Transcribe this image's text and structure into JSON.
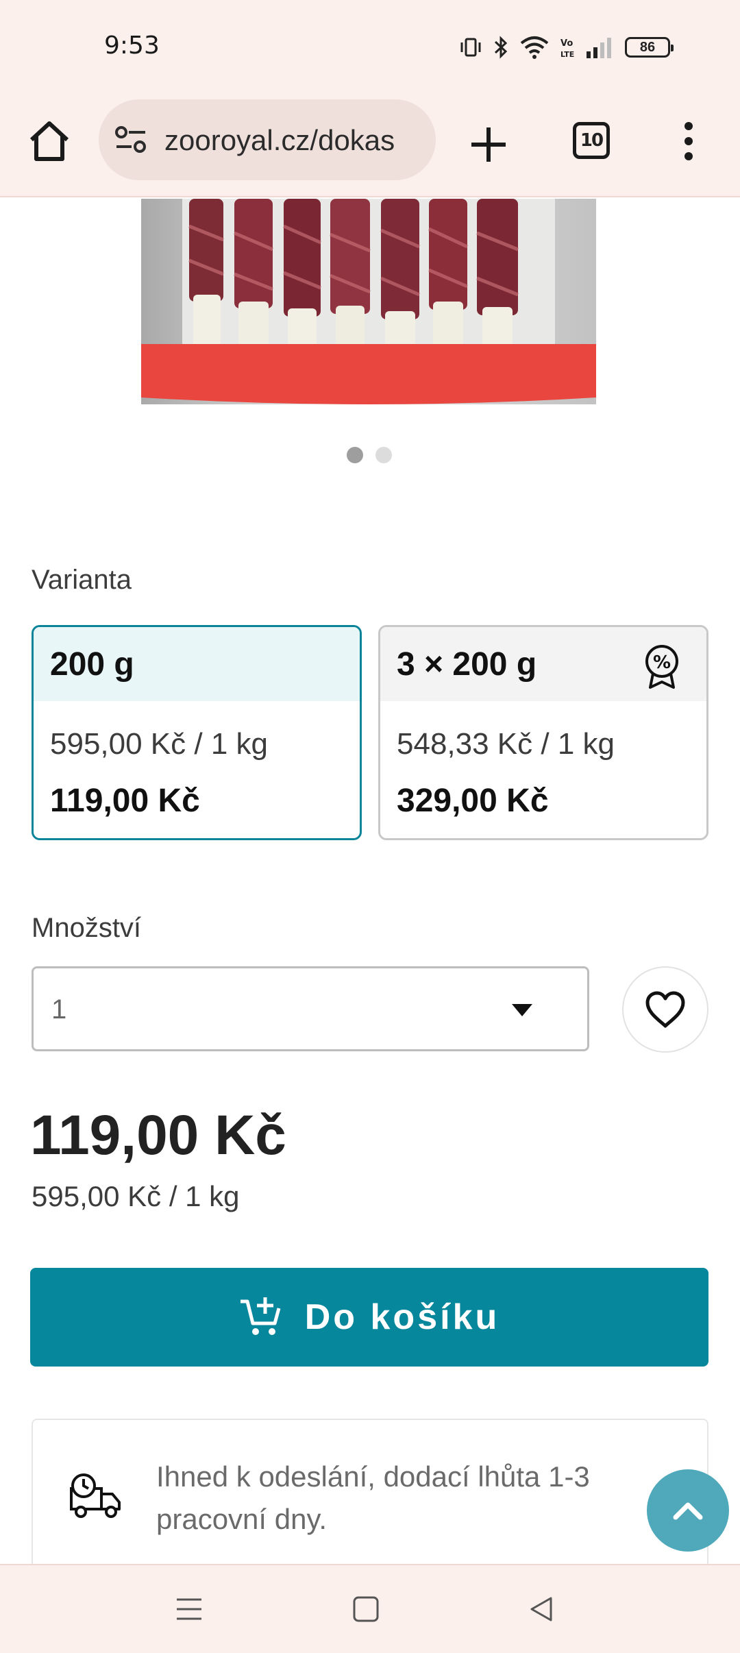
{
  "status_bar": {
    "time": "9:53",
    "battery": "86",
    "icons": [
      "vibrate-icon",
      "bluetooth-icon",
      "wifi-icon",
      "volte-icon",
      "signal-icon",
      "battery-icon"
    ]
  },
  "browser": {
    "url": "zooroyal.cz/dokas",
    "tab_count": "10",
    "icons": [
      "home-icon",
      "site-settings-icon",
      "new-tab-icon",
      "menu-icon"
    ]
  },
  "gallery": {
    "slides": 2,
    "active": 0
  },
  "variant": {
    "label": "Varianta",
    "options": [
      {
        "name": "200 g",
        "unit_price": "595,00 Kč / 1 kg",
        "price": "119,00 Kč",
        "selected": true
      },
      {
        "name": "3 × 200 g",
        "unit_price": "548,33 Kč / 1 kg",
        "price": "329,00 Kč",
        "selected": false,
        "badge": "discount-badge-icon"
      }
    ]
  },
  "quantity": {
    "label": "Množství",
    "value": "1"
  },
  "price": {
    "total": "119,00 Kč",
    "unit": "595,00 Kč / 1 kg"
  },
  "cart": {
    "label": "Do košíku"
  },
  "delivery": {
    "text": "Ihned k odeslání, dodací lhůta 1-3 pracovní dny."
  },
  "colors": {
    "accent": "#07879c",
    "selected_border": "#0a8498",
    "scroll_top": "#4fa9ba",
    "chrome_bg": "#fcf0ec"
  }
}
